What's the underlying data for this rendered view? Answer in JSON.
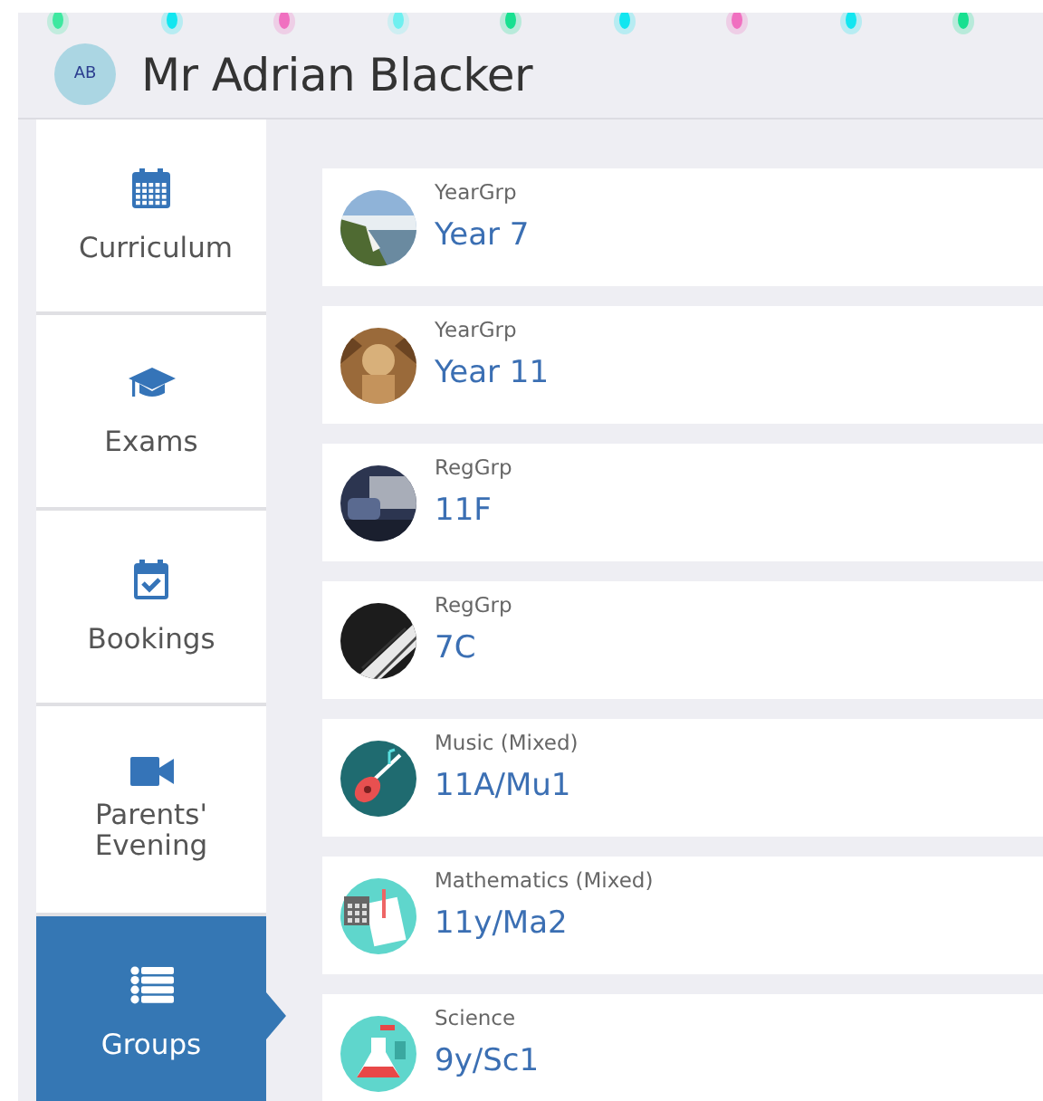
{
  "header": {
    "initials": "AB",
    "name": "Mr Adrian Blacker"
  },
  "tabs": [
    {
      "label": "Curriculum",
      "selected": false
    },
    {
      "label": "Exams",
      "selected": false
    },
    {
      "label": "Bookings",
      "selected": false
    },
    {
      "label": "Parents' Evening",
      "selected": false
    },
    {
      "label": "Groups",
      "selected": true
    }
  ],
  "groups": [
    {
      "type": "YearGrp",
      "name": "Year 7",
      "kind": "picture"
    },
    {
      "type": "YearGrp",
      "name": "Year 11",
      "kind": "picture"
    },
    {
      "type": "RegGrp",
      "name": "11F",
      "kind": "picture"
    },
    {
      "type": "RegGrp",
      "name": "7C",
      "kind": "picture"
    },
    {
      "type": "Music (Mixed)",
      "name": "11A/Mu1",
      "kind": "music"
    },
    {
      "type": "Mathematics (Mixed)",
      "name": "11y/Ma2",
      "kind": "maths"
    },
    {
      "type": "Science",
      "name": "9y/Sc1",
      "kind": "science"
    }
  ]
}
